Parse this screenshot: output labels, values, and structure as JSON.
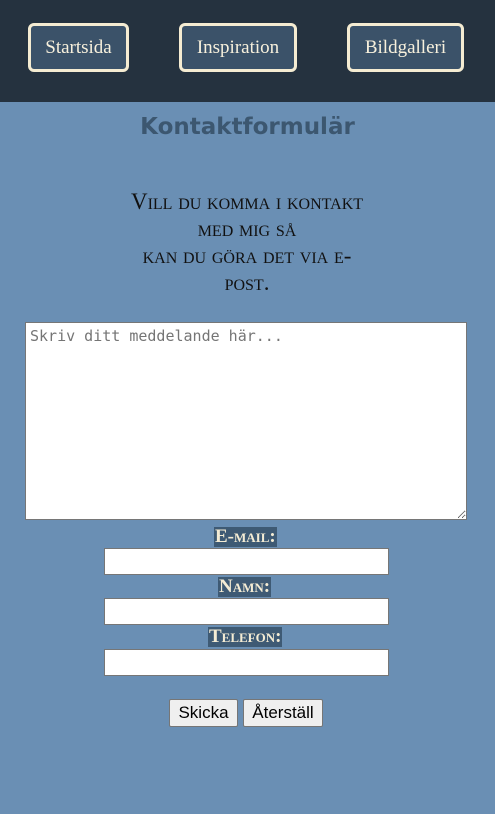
{
  "nav": {
    "items": [
      {
        "label": "Startsida"
      },
      {
        "label": "Inspiration"
      },
      {
        "label": "Bildgalleri"
      }
    ]
  },
  "page": {
    "title": "Kontaktformulär",
    "intro_lines": [
      "Vill du komma i kontakt",
      "med mig så",
      "kan du göra det via e-",
      "post."
    ]
  },
  "form": {
    "message_placeholder": "Skriv ditt meddelande här...",
    "message_value": "",
    "email_label": "E-mail:",
    "email_value": "",
    "name_label": "Namn:",
    "name_value": "",
    "phone_label": "Telefon:",
    "phone_value": "",
    "submit_label": "Skicka",
    "reset_label": "Återställ"
  },
  "colors": {
    "page_background": "#6a8fb4",
    "navbar_background": "#25323f",
    "nav_button_background": "#3b5269",
    "nav_button_border": "#f5ecd2",
    "title_color": "#3c5770",
    "label_background": "#3e5a74"
  }
}
